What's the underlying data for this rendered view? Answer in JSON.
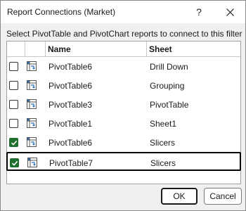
{
  "window": {
    "title": "Report Connections (Market)",
    "help_glyph": "?",
    "close_icon": "close-icon"
  },
  "prompt": "Select PivotTable and PivotChart reports to connect to this filter",
  "table": {
    "columns": [
      "",
      "",
      "Name",
      "Sheet"
    ],
    "rows": [
      {
        "checked": false,
        "name": "PivotTable6",
        "sheet": "Drill Down",
        "icon": "pivottable-icon"
      },
      {
        "checked": false,
        "name": "PivotTable6",
        "sheet": "Grouping",
        "icon": "pivottable-icon"
      },
      {
        "checked": false,
        "name": "PivotTable3",
        "sheet": "PivotTable",
        "icon": "pivottable-icon"
      },
      {
        "checked": false,
        "name": "PivotTable1",
        "sheet": "Sheet1",
        "icon": "pivottable-icon"
      },
      {
        "checked": true,
        "name": "PivotTable6",
        "sheet": "Slicers",
        "icon": "pivottable-icon"
      },
      {
        "checked": true,
        "name": "PivotTable7",
        "sheet": "Slicers",
        "icon": "pivottable-icon",
        "focused": true
      }
    ]
  },
  "buttons": {
    "ok": "OK",
    "cancel": "Cancel"
  },
  "colors": {
    "check_fill": "#1f6f2f",
    "dialog_bg": "#f0f0f0",
    "icon_blue": "#2f6fbf"
  }
}
